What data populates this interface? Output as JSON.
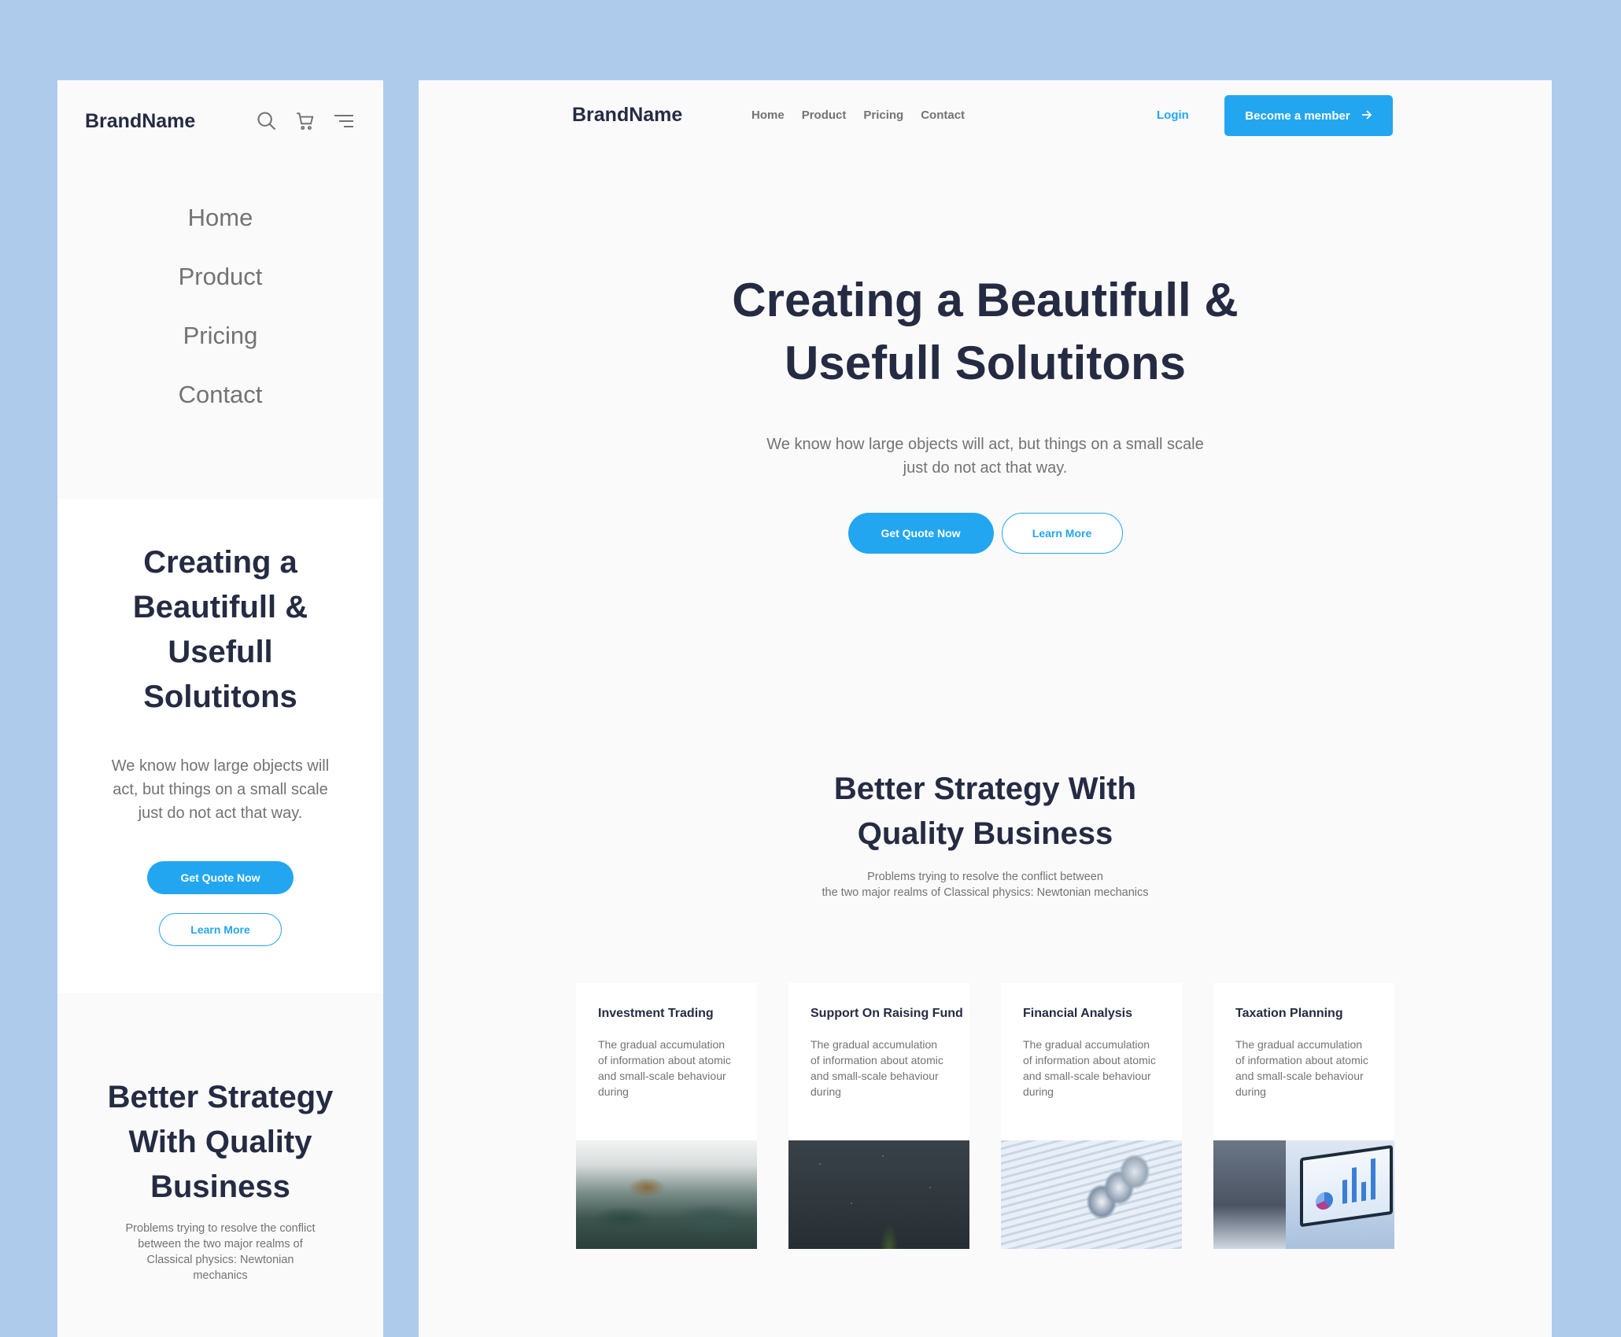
{
  "colors": {
    "background": "#AECBEB",
    "accent": "#23A6F0",
    "heading": "#252B42",
    "body_text": "#737373"
  },
  "mobile": {
    "brand": "BrandName",
    "icons": [
      "search-icon",
      "cart-icon",
      "menu-icon"
    ],
    "nav": [
      "Home",
      "Product",
      "Pricing",
      "Contact"
    ],
    "hero": {
      "title": "Creating a Beautifull & Usefull Solutitons",
      "subtitle": "We know how large objects will act, but things on a small scale just do not act that way.",
      "primary_button": "Get Quote Now",
      "secondary_button": "Learn More"
    },
    "strategy": {
      "title": "Better Strategy With Quality Business",
      "subtitle": "Problems trying to resolve the conflict between the two major realms of Classical physics: Newtonian mechanics"
    }
  },
  "desktop": {
    "brand": "BrandName",
    "nav": [
      "Home",
      "Product",
      "Pricing",
      "Contact"
    ],
    "login": "Login",
    "member_button": "Become a member",
    "hero": {
      "title": "Creating a Beautifull & Usefull Solutitons",
      "subtitle": "We know how large objects will act, but things on a small scale just do not act that way.",
      "primary_button": "Get Quote Now",
      "secondary_button": "Learn More"
    },
    "strategy": {
      "title": "Better Strategy With Quality Business",
      "subtitle_line1": "Problems trying to resolve the conflict between",
      "subtitle_line2": "the two major realms of Classical physics: Newtonian mechanics"
    },
    "cards": [
      {
        "title": "Investment Trading",
        "text": "The gradual accumulation of information about atomic and small-scale behaviour during",
        "image": "forest-photo"
      },
      {
        "title": "Support On Raising Fund",
        "text": "The gradual accumulation of information about atomic and small-scale behaviour during",
        "image": "night-sky-photo"
      },
      {
        "title": "Financial Analysis",
        "text": "The gradual accumulation of information about atomic and small-scale behaviour during",
        "image": "coins-chart-photo"
      },
      {
        "title": "Taxation Planning",
        "text": "The gradual accumulation of information about atomic and small-scale behaviour during",
        "image": "laptop-analytics-photo"
      }
    ]
  }
}
